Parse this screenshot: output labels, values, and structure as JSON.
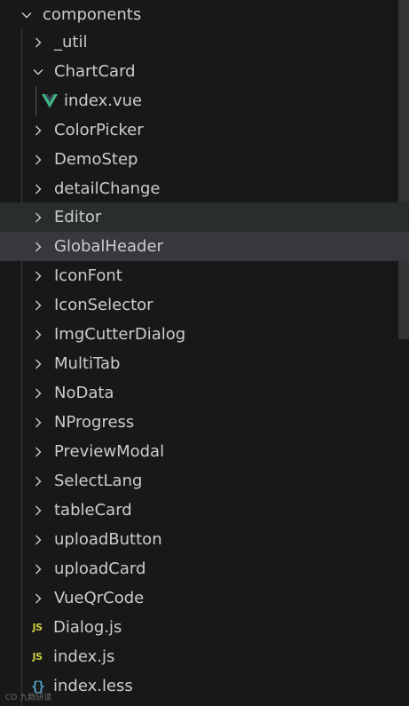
{
  "explorer": {
    "root": {
      "label": "components",
      "icon": "chevron-down-icon"
    },
    "folders": [
      {
        "label": "_util",
        "icon": "chevron-right-icon"
      },
      {
        "label": "ChartCard",
        "icon": "chevron-down-icon"
      }
    ],
    "chartcard_child": {
      "label": "index.vue",
      "icon": "vue-icon"
    },
    "folders_after": [
      {
        "label": "ColorPicker"
      },
      {
        "label": "DemoStep"
      },
      {
        "label": "detailChange"
      },
      {
        "label": "Editor"
      },
      {
        "label": "GlobalHeader"
      },
      {
        "label": "IconFont"
      },
      {
        "label": "IconSelector"
      },
      {
        "label": "ImgCutterDialog"
      },
      {
        "label": "MultiTab"
      },
      {
        "label": "NoData"
      },
      {
        "label": "NProgress"
      },
      {
        "label": "PreviewModal"
      },
      {
        "label": "SelectLang"
      },
      {
        "label": "tableCard"
      },
      {
        "label": "uploadButton"
      },
      {
        "label": "uploadCard"
      },
      {
        "label": "VueQrCode"
      }
    ],
    "files": [
      {
        "label": "Dialog.js",
        "icon_text": "JS"
      },
      {
        "label": "index.js",
        "icon_text": "JS"
      },
      {
        "label": "index.less",
        "icon_text": "{}"
      }
    ],
    "hover_item": "Editor",
    "selected_item": "GlobalHeader"
  },
  "watermark": {
    "text": "CO 九数研读"
  },
  "colors": {
    "background": "#181818",
    "text": "#cccccc",
    "hover": "#2a2d2e",
    "selected": "#37373d",
    "vue": "#41b883",
    "js": "#cbcb41",
    "less": "#519aba"
  }
}
